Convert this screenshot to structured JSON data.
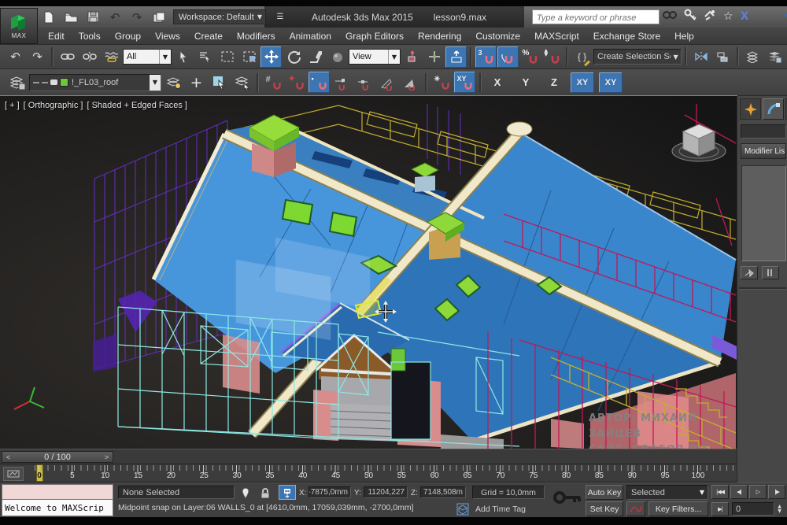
{
  "colors": {
    "active_blue": "#3d74b2",
    "magnet_red": "#c2404e",
    "roof_blue": "#4796dc",
    "accent_green": "#7ed832",
    "beam_cream": "#efe6c0",
    "wire_purple": "#6a2fd4",
    "wire_cyan": "#8ae8e4",
    "wire_yellow": "#c2ae2e",
    "wire_crimson": "#c01858",
    "wall_salmon": "#d98c8c"
  },
  "titlebar": {
    "workspace_label": "Workspace: Default",
    "app_title": "Autodesk 3ds Max  2015",
    "file_name": "lesson9.max",
    "search_placeholder": "Type a keyword or phrase"
  },
  "menus": [
    "Edit",
    "Tools",
    "Group",
    "Views",
    "Create",
    "Modifiers",
    "Animation",
    "Graph Editors",
    "Rendering",
    "Customize",
    "MAXScript",
    "Exchange Store",
    "Help"
  ],
  "toolbar1": {
    "filter_value": "All",
    "ref_coord_value": "View",
    "snap_value": "3",
    "selection_set_value": "Create Selection Se"
  },
  "layer_toolbar": {
    "current_layer": "!_FL03_roof"
  },
  "axis_constraints": [
    {
      "label": "X",
      "active": false
    },
    {
      "label": "Y",
      "active": false
    },
    {
      "label": "Z",
      "active": false
    },
    {
      "label": "XY",
      "active": true
    },
    {
      "label": "XY",
      "active": true
    }
  ],
  "viewport": {
    "label_plus": "[ + ]",
    "label_view": "[ Orthographic ]",
    "label_shading": "[ Shaded + Edged Faces ]",
    "watermark_line1": "АВТОР: МИХАИЛ ЗАЙЦЕВ",
    "watermark_line2": "САЙТ: GRAFOB.RU"
  },
  "command_panel": {
    "modifier_list_label": "Modifier Lis"
  },
  "timeline": {
    "slider_value": "0 / 100",
    "prev_arrow": "<",
    "next_arrow": ">",
    "ticks": [
      "0",
      "5",
      "10",
      "15",
      "20",
      "25",
      "30",
      "35",
      "40",
      "45",
      "50",
      "55",
      "60",
      "65",
      "70",
      "75",
      "80",
      "85",
      "90",
      "95",
      "100"
    ]
  },
  "status": {
    "listener_text": "Welcome to MAXScrip",
    "selection_status": "None Selected",
    "prompt_line": "Midpoint snap on Layer:06 WALLS_0 at [4610,0mm, 17059,039mm, -2700,0mm]",
    "x_label": "X:",
    "x_value": "-7875,0mm",
    "y_label": "Y:",
    "y_value": "11204,227",
    "z_label": "Z:",
    "z_value": "7148,508m",
    "grid_label": "Grid = 10,0mm",
    "add_time_tag_label": "Add Time Tag"
  },
  "animation": {
    "auto_key_label": "Auto Key",
    "set_key_label": "Set Key",
    "key_mode_value": "Selected",
    "key_filters_label": "Key Filters...",
    "frame_value": "0"
  },
  "playback": {
    "buttons": [
      {
        "name": "goto-start-button",
        "glyph": "|◀◀"
      },
      {
        "name": "previous-frame-button",
        "glyph": "◀|"
      },
      {
        "name": "play-button",
        "glyph": "▷"
      },
      {
        "name": "next-frame-button",
        "glyph": "|▶"
      }
    ],
    "goto_end_glyph": "▶|"
  }
}
